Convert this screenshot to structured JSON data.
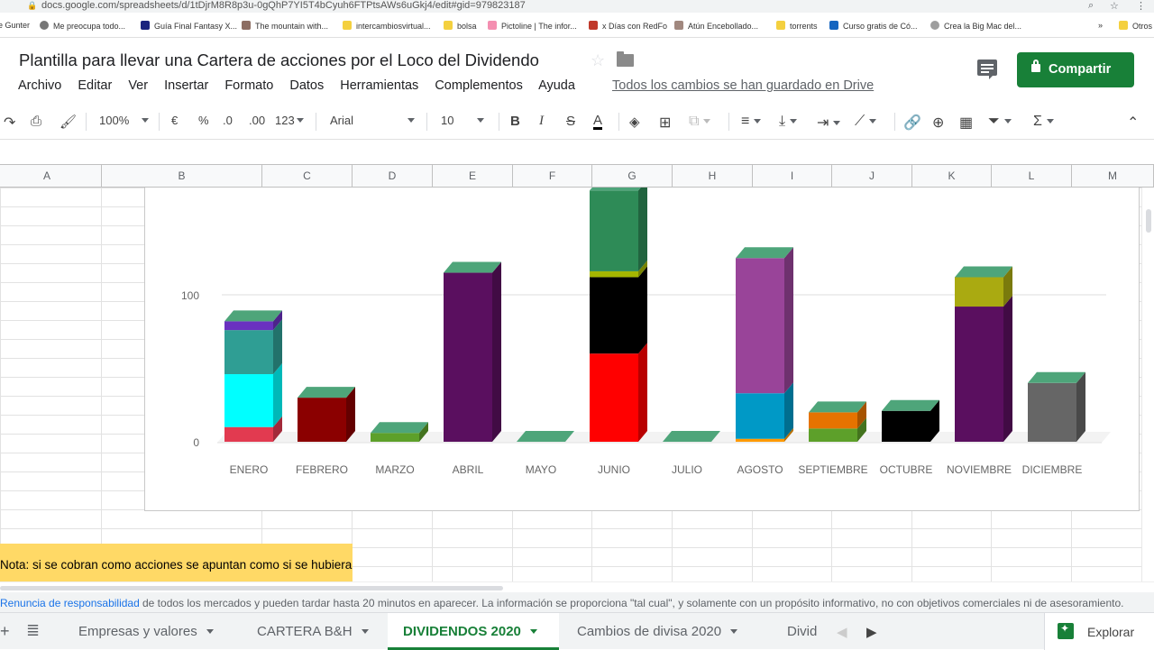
{
  "browser": {
    "url": "docs.google.com/spreadsheets/d/1tDjrM8R8p3u-0gQhP7YI5T4bCyuh6FTPtsAWs6uGkj4/edit#gid=979823187",
    "bookmarks": [
      {
        "label": "e Gunter",
        "color": "#ffffff"
      },
      {
        "label": "Me preocupa todo...",
        "color": "#777777"
      },
      {
        "label": "Guía Final Fantasy X...",
        "color": "#1a237e"
      },
      {
        "label": "The mountain with...",
        "color": "#8d6e63"
      },
      {
        "label": "intercambiosvirtual...",
        "color": "#f4d03f"
      },
      {
        "label": "bolsa",
        "color": "#f4d03f"
      },
      {
        "label": "Pictoline | The infor...",
        "color": "#f48fb1"
      },
      {
        "label": "x Días con RedFo",
        "color": "#c0392b"
      },
      {
        "label": "Atún Encebollado...",
        "color": "#a1887f"
      },
      {
        "label": "torrents",
        "color": "#f4d03f"
      },
      {
        "label": "Curso gratis de Có...",
        "color": "#1565c0"
      },
      {
        "label": "Crea la Big Mac del...",
        "color": "#9e9e9e"
      },
      {
        "label": "Otros",
        "color": "#f4d03f"
      }
    ],
    "more_bookmarks": "»"
  },
  "document": {
    "title": "Plantilla para llevar una Cartera de acciones por el Loco del Dividendo",
    "saved_status": "Todos los cambios se han guardado en Drive",
    "share_label": "Compartir"
  },
  "menu": [
    "Archivo",
    "Editar",
    "Ver",
    "Insertar",
    "Formato",
    "Datos",
    "Herramientas",
    "Complementos",
    "Ayuda"
  ],
  "toolbar": {
    "zoom": "100%",
    "currency": "€",
    "percent": "%",
    "dec_less": ".0",
    "dec_more": ".00",
    "format_more": "123",
    "font": "Arial",
    "font_size": "10",
    "bold": "B",
    "italic": "I",
    "strike": "S",
    "text_color": "A"
  },
  "columns": [
    "A",
    "B",
    "C",
    "D",
    "E",
    "F",
    "G",
    "H",
    "I",
    "J",
    "K",
    "L",
    "M"
  ],
  "note_text": "Nota: si se cobran como acciones se apuntan como si se hubieran cobrado como dinero en efectivo y se apunta como",
  "disclaimer": {
    "link": "Renuncia de responsabilidad",
    "text": "de todos los mercados y pueden tardar hasta 20 minutos en aparecer. La información se proporciona \"tal cual\", y solamente con un propósito informativo, no con objetivos comerciales ni de asesoramiento."
  },
  "sheet_tabs": [
    {
      "label": "Empresas y valores",
      "active": false
    },
    {
      "label": "CARTERA B&H",
      "active": false
    },
    {
      "label": "DIVIDENDOS 2020",
      "active": true
    },
    {
      "label": "Cambios de divisa 2020",
      "active": false
    },
    {
      "label": "Divid",
      "active": false
    }
  ],
  "explore_label": "Explorar",
  "chart_data": {
    "type": "bar",
    "stacked": true,
    "style": "3d",
    "categories": [
      "ENERO",
      "FEBRERO",
      "MARZO",
      "ABRIL",
      "MAYO",
      "JUNIO",
      "JULIO",
      "AGOSTO",
      "SEPTIEMBRE",
      "OCTUBRE",
      "NOVIEMBRE",
      "DICIEMBRE"
    ],
    "y_ticks": [
      0,
      100
    ],
    "ylim": [
      0,
      134
    ],
    "series": [
      {
        "color": "#e23a50",
        "values": [
          10,
          0,
          0,
          0,
          0,
          0,
          0,
          0,
          0,
          0,
          0,
          0
        ]
      },
      {
        "color": "#00ffff",
        "values": [
          36,
          0,
          0,
          0,
          0,
          0,
          0,
          0,
          0,
          0,
          0,
          0
        ]
      },
      {
        "color": "#2f9e94",
        "values": [
          30,
          0,
          0,
          0,
          0,
          0,
          0,
          0,
          0,
          0,
          0,
          0
        ]
      },
      {
        "color": "#6a31c0",
        "values": [
          6,
          0,
          0,
          0,
          0,
          0,
          0,
          0,
          0,
          0,
          0,
          0
        ]
      },
      {
        "color": "#8b0000",
        "values": [
          0,
          30,
          0,
          0,
          0,
          0,
          0,
          0,
          0,
          0,
          0,
          0
        ]
      },
      {
        "color": "#5da02a",
        "values": [
          0,
          0,
          6,
          0,
          0,
          0,
          0,
          0,
          9,
          0,
          0,
          0
        ]
      },
      {
        "color": "#5a0f5f",
        "values": [
          0,
          0,
          0,
          115,
          0,
          0,
          0,
          0,
          0,
          0,
          92,
          0
        ]
      },
      {
        "color": "#ff0000",
        "values": [
          0,
          0,
          0,
          0,
          0,
          60,
          0,
          0,
          0,
          0,
          0,
          0
        ]
      },
      {
        "color": "#000000",
        "values": [
          0,
          0,
          0,
          0,
          0,
          52,
          0,
          0,
          0,
          21,
          0,
          0
        ]
      },
      {
        "color": "#a5b600",
        "values": [
          0,
          0,
          0,
          0,
          0,
          4,
          0,
          0,
          0,
          0,
          0,
          0
        ]
      },
      {
        "color": "#2e8b57",
        "values": [
          0,
          0,
          0,
          0,
          0,
          55,
          0,
          0,
          0,
          0,
          0,
          0
        ]
      },
      {
        "color": "#ff9900",
        "values": [
          0,
          0,
          0,
          0,
          0,
          0,
          0,
          2,
          0,
          0,
          0,
          0
        ]
      },
      {
        "color": "#0099c6",
        "values": [
          0,
          0,
          0,
          0,
          0,
          0,
          0,
          31,
          0,
          0,
          0,
          0
        ]
      },
      {
        "color": "#994499",
        "values": [
          0,
          0,
          0,
          0,
          0,
          0,
          0,
          92,
          0,
          0,
          0,
          0
        ]
      },
      {
        "color": "#e67300",
        "values": [
          0,
          0,
          0,
          0,
          0,
          0,
          0,
          0,
          11,
          0,
          0,
          0
        ]
      },
      {
        "color": "#aaaa11",
        "values": [
          0,
          0,
          0,
          0,
          0,
          0,
          0,
          0,
          0,
          0,
          20,
          0
        ]
      },
      {
        "color": "#666666",
        "values": [
          0,
          0,
          0,
          0,
          0,
          0,
          0,
          0,
          0,
          0,
          0,
          40
        ]
      }
    ],
    "top_cap_color": "#4ea57a",
    "grid": true
  }
}
